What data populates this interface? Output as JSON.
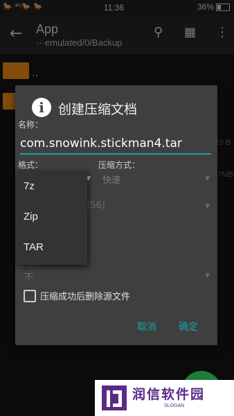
{
  "status_bar": {
    "left_icons": "🐎 ⁴ᴳ🐎 🐎",
    "time": "11:36",
    "battery": "36%"
  },
  "toolbar": {
    "title": "App",
    "path": "···emulated/0/Backup"
  },
  "file_list": {
    "parent_label": "..",
    "size_1": "23 B",
    "size_2": "7MB"
  },
  "dialog": {
    "title": "创建压缩文档",
    "name_label": "名称：",
    "name_value": "com.snowink.stickman4.tar",
    "format_label": "格式：",
    "compression_label": "压缩方式：",
    "compression_value": "快速",
    "encryption_value": "256)",
    "split_label": "分卷：",
    "split_value": "不",
    "delete_source_label": "压缩成功后删除源文件",
    "delete_source_checked": false,
    "cancel": "取消",
    "confirm": "确定"
  },
  "format_dropdown": {
    "options": [
      "7z",
      "Zip",
      "TAR"
    ]
  },
  "watermark": {
    "text": "润信软件园",
    "slogan": "SLOGAN"
  },
  "colors": {
    "accent": "#19a2a6",
    "folder": "#f08a16",
    "watermark": "#5b2a86"
  }
}
